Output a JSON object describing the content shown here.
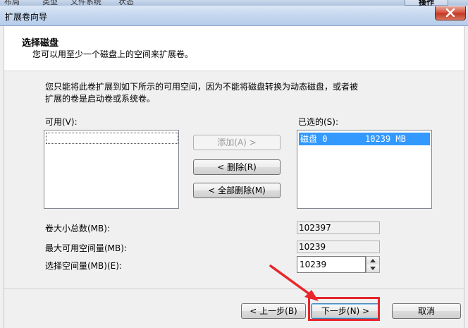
{
  "background": {
    "tab_fragments": [
      "布局",
      "类型",
      "文件系统",
      "状态"
    ],
    "right_button": "操作"
  },
  "window": {
    "title": "扩展卷向导"
  },
  "header": {
    "title": "选择磁盘",
    "subtitle": "您可以用至少一个磁盘上的空间来扩展卷。"
  },
  "description_line1": "您只能将此卷扩展到如下所示的可用空间，因为不能将磁盘转换为动态磁盘，或者被",
  "description_line2": "扩展的卷是启动卷或系统卷。",
  "available": {
    "label": "可用(V):",
    "items": []
  },
  "selected": {
    "label": "已选的(S):",
    "items": [
      {
        "disk": "磁盘 0",
        "size": "10239 MB"
      }
    ]
  },
  "buttons": {
    "add": "添加(A) >",
    "remove": "< 删除(R)",
    "remove_all": "< 全部删除(M)"
  },
  "fields": {
    "total_label": "卷大小总数(MB):",
    "total_value": "102397",
    "max_label": "最大可用空间量(MB):",
    "max_value": "10239",
    "select_label": "选择空间量(MB)(E):",
    "select_value": "10239"
  },
  "nav": {
    "back": "< 上一步(B)",
    "next": "下一步(N) >",
    "cancel": "取消"
  },
  "colors": {
    "highlight": "#e8262b",
    "selection": "#3399ff"
  }
}
